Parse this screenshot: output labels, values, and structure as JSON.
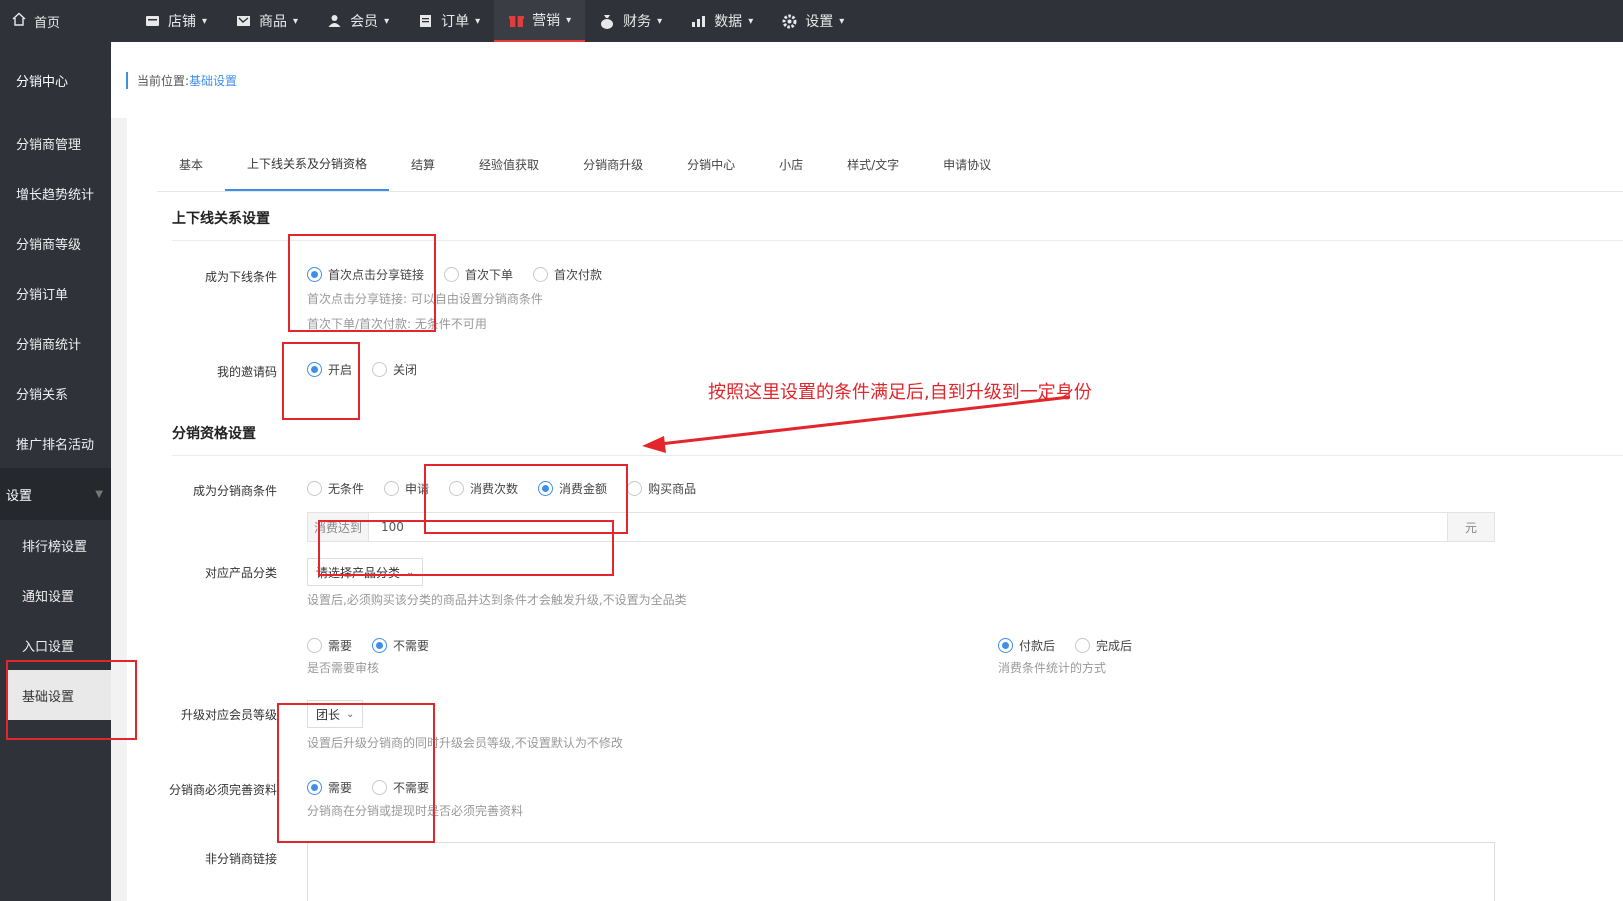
{
  "topnav": {
    "home": "首页",
    "items": [
      {
        "label": "店铺",
        "icon": "store-icon"
      },
      {
        "label": "商品",
        "icon": "goods-icon"
      },
      {
        "label": "会员",
        "icon": "member-icon"
      },
      {
        "label": "订单",
        "icon": "order-icon"
      },
      {
        "label": "营销",
        "icon": "gift-icon",
        "active": true
      },
      {
        "label": "财务",
        "icon": "finance-icon"
      },
      {
        "label": "数据",
        "icon": "data-icon"
      },
      {
        "label": "设置",
        "icon": "gear-icon"
      }
    ]
  },
  "sidebar": {
    "head": "分销中心",
    "items": [
      "分销商管理",
      "增长趋势统计",
      "分销商等级",
      "分销订单",
      "分销商统计",
      "分销关系",
      "推广排名活动"
    ],
    "group": "设置",
    "sub": [
      "排行榜设置",
      "通知设置",
      "入口设置",
      "基础设置"
    ]
  },
  "breadcrumb": {
    "prefix": "当前位置:",
    "current": "基础设置"
  },
  "tabs": [
    "基本",
    "上下线关系及分销资格",
    "结算",
    "经验值获取",
    "分销商升级",
    "分销中心",
    "小店",
    "样式/文字",
    "申请协议"
  ],
  "relation": {
    "title": "上下线关系设置",
    "cond_label": "成为下线条件",
    "cond_options": [
      "首次点击分享链接",
      "首次下单",
      "首次付款"
    ],
    "cond_hint1": "首次点击分享链接: 可以自由设置分销商条件",
    "cond_hint2": "首次下单/首次付款: 无条件不可用",
    "invite_label": "我的邀请码",
    "invite_options": [
      "开启",
      "关闭"
    ]
  },
  "qualify": {
    "title": "分销资格设置",
    "cond_label": "成为分销商条件",
    "cond_options": [
      "无条件",
      "申请",
      "消费次数",
      "消费金额",
      "购买商品"
    ],
    "amount_prefix": "消费达到",
    "amount_value": "100",
    "amount_unit": "元",
    "category_label": "对应产品分类",
    "category_select": "请选择产品分类",
    "category_hint": "设置后,必须购买该分类的商品并达到条件才会触发升级,不设置为全品类",
    "audit_options": [
      "需要",
      "不需要"
    ],
    "audit_hint": "是否需要审核",
    "stat_options": [
      "付款后",
      "完成后"
    ],
    "stat_hint": "消费条件统计的方式",
    "level_label": "升级对应会员等级",
    "level_select": "团长",
    "level_hint": "设置后升级分销商的同时升级会员等级,不设置默认为不修改",
    "profile_label": "分销商必须完善资料",
    "profile_options": [
      "需要",
      "不需要"
    ],
    "profile_hint": "分销商在分销或提现时是否必须完善资料",
    "link_label": "非分销商链接"
  },
  "annotation": "按照这里设置的条件满足后,自到升级到一定身份",
  "colors": {
    "accent": "#3f8ee8",
    "annotation_red": "#e2262b",
    "nav_bg": "#2f3238"
  }
}
